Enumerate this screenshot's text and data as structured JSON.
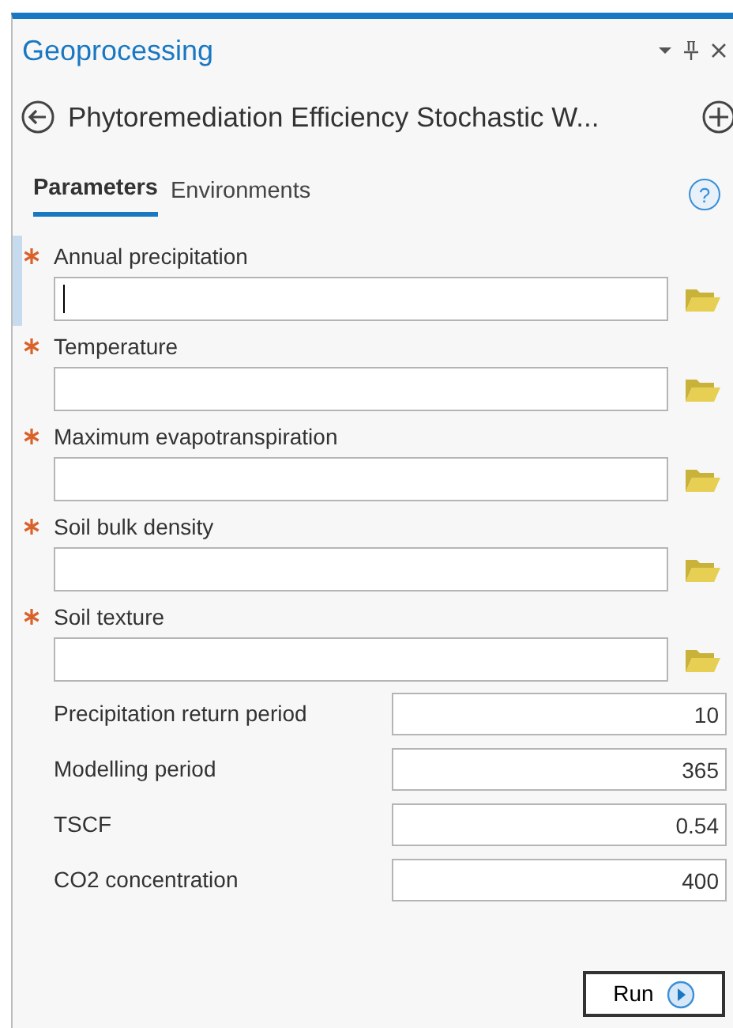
{
  "pane": {
    "title": "Geoprocessing"
  },
  "tool": {
    "title": "Phytoremediation Efficiency Stochastic W..."
  },
  "help_button": {
    "label": "?"
  },
  "tabs": [
    {
      "label": "Parameters",
      "selected": true
    },
    {
      "label": "Environments",
      "selected": false
    }
  ],
  "parameters": [
    {
      "kind": "file",
      "label": "Annual precipitation",
      "required": true,
      "focused": true
    },
    {
      "kind": "file",
      "label": "Temperature",
      "required": true,
      "focused": false
    },
    {
      "kind": "file",
      "label": "Maximum evapotranspiration",
      "required": true,
      "focused": false
    },
    {
      "kind": "file",
      "label": "Soil bulk density",
      "required": true,
      "focused": false
    },
    {
      "kind": "file",
      "label": "Soil texture",
      "required": true,
      "focused": false
    },
    {
      "kind": "number",
      "label": "Precipitation return period",
      "value": "10"
    },
    {
      "kind": "number",
      "label": "Modelling period",
      "value": "365"
    },
    {
      "kind": "number",
      "label": "TSCF",
      "value": "0.54"
    },
    {
      "kind": "number",
      "label": "CO2 concentration",
      "value": "400"
    }
  ],
  "run_button": {
    "label": "Run"
  }
}
